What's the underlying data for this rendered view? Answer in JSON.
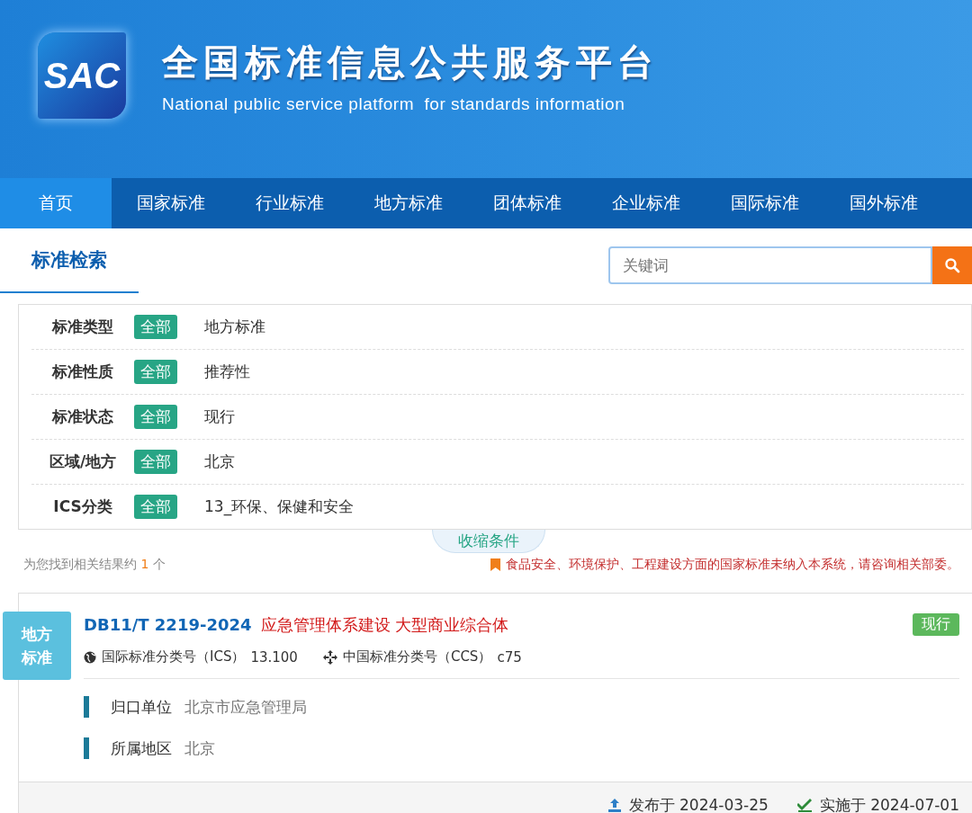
{
  "header": {
    "logo_text": "SAC",
    "title": "全国标准信息公共服务平台",
    "subtitle": "National public service platform  for standards information"
  },
  "nav": [
    {
      "label": "首页",
      "selected": true
    },
    {
      "label": "国家标准",
      "selected": false
    },
    {
      "label": "行业标准",
      "selected": false
    },
    {
      "label": "地方标准",
      "selected": false
    },
    {
      "label": "团体标准",
      "selected": false
    },
    {
      "label": "企业标准",
      "selected": false
    },
    {
      "label": "国际标准",
      "selected": false
    },
    {
      "label": "国外标准",
      "selected": false
    }
  ],
  "section_title": "标准检索",
  "search": {
    "placeholder": "关键词"
  },
  "filters": [
    {
      "label": "标准类型",
      "all": "全部",
      "value": "地方标准"
    },
    {
      "label": "标准性质",
      "all": "全部",
      "value": "推荐性"
    },
    {
      "label": "标准状态",
      "all": "全部",
      "value": "现行"
    },
    {
      "label": "区域/地方",
      "all": "全部",
      "value": "北京"
    },
    {
      "label": "ICS分类",
      "all": "全部",
      "value": "13_环保、保健和安全"
    }
  ],
  "collapse_button": "收缩条件",
  "result_count": {
    "prefix": "为您找到相关结果约",
    "count": "1",
    "suffix": "个"
  },
  "notice": "食品安全、环境保护、工程建设方面的国家标准未纳入本系统，请咨询相关部委。",
  "results": [
    {
      "type_badge": "地方标准",
      "code": "DB11/T 2219-2024",
      "title": "应急管理体系建设 大型商业综合体",
      "status": "现行",
      "ics_label": "国际标准分类号（ICS）",
      "ics": "13.100",
      "ccs_label": "中国标准分类号（CCS）",
      "ccs": "c75",
      "details": [
        {
          "label": "归口单位",
          "value": "北京市应急管理局"
        },
        {
          "label": "所属地区",
          "value": "北京"
        }
      ],
      "published": "发布于 2024-03-25",
      "effective": "实施于 2024-07-01"
    }
  ]
}
